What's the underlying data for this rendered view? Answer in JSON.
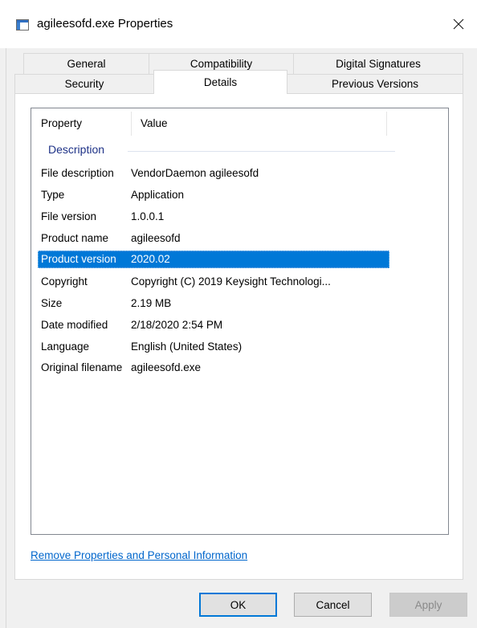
{
  "window": {
    "title": "agileesofd.exe Properties",
    "close_glyph": "✕"
  },
  "tabs": {
    "row1": [
      "General",
      "Compatibility",
      "Digital Signatures"
    ],
    "row2": [
      "Security",
      "Details",
      "Previous Versions"
    ],
    "active": "Details"
  },
  "list": {
    "columns": [
      "Property",
      "Value"
    ],
    "group": "Description",
    "rows": [
      {
        "property": "File description",
        "value": "VendorDaemon agileesofd"
      },
      {
        "property": "Type",
        "value": "Application"
      },
      {
        "property": "File version",
        "value": "1.0.0.1"
      },
      {
        "property": "Product name",
        "value": "agileesofd"
      },
      {
        "property": "Product version",
        "value": "2020.02",
        "selected": true
      },
      {
        "property": "Copyright",
        "value": "Copyright (C)  2019 Keysight Technologi..."
      },
      {
        "property": "Size",
        "value": "2.19 MB"
      },
      {
        "property": "Date modified",
        "value": "2/18/2020 2:54 PM"
      },
      {
        "property": "Language",
        "value": "English (United States)"
      },
      {
        "property": "Original filename",
        "value": "agileesofd.exe"
      }
    ]
  },
  "link": "Remove Properties and Personal Information",
  "buttons": {
    "ok": "OK",
    "cancel": "Cancel",
    "apply": "Apply"
  },
  "colors": {
    "selection": "#0078d7",
    "link": "#0066cc",
    "group_header": "#1e3287"
  },
  "icons": {
    "title": "exe-window-icon",
    "close": "close-icon"
  }
}
